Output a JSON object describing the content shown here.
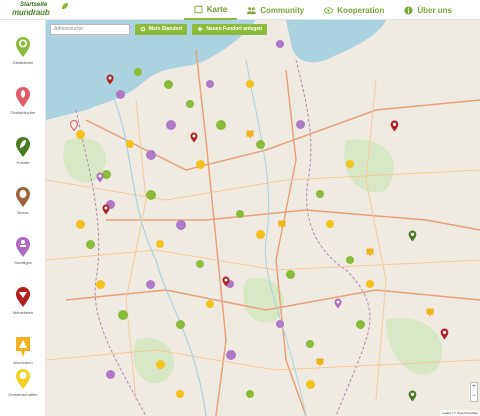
{
  "app": {
    "brand_top": "Startseite",
    "brand_bottom": "mundraub",
    "accent_color": "#8bbb3a"
  },
  "nav": [
    {
      "label": "Karte",
      "icon": "map-icon",
      "active": true
    },
    {
      "label": "Community",
      "icon": "community-icon",
      "active": false
    },
    {
      "label": "Kooperation",
      "icon": "cooperation-icon",
      "active": false
    },
    {
      "label": "Über uns",
      "icon": "info-icon",
      "active": false
    }
  ],
  "sidebar": {
    "categories": [
      {
        "label": "Obstbäume",
        "icon": "fruit-tree-icon",
        "color": "#8bbb3a"
      },
      {
        "label": "Obststräucher",
        "icon": "berry-bush-icon",
        "color": "#e05a6a"
      },
      {
        "label": "Kräuter",
        "icon": "herb-icon",
        "color": "#4a7a26"
      },
      {
        "label": "Nüsse",
        "icon": "nut-icon",
        "color": "#a0643a"
      },
      {
        "label": "Sonstiges",
        "icon": "misc-icon",
        "color": "#b06ac0"
      },
      {
        "label": "Meldelisten",
        "icon": "alert-list-icon",
        "color": "#b22020"
      },
      {
        "label": "Mundraum",
        "icon": "space-icon",
        "color": "#f0b21e"
      },
      {
        "label": "Gemeinschaften",
        "icon": "community-group-icon",
        "color": "#f3d120"
      }
    ]
  },
  "map": {
    "search_placeholder": "Adresssuche",
    "my_location_label": "Mein Standort",
    "new_find_label": "Neuen Fundort anlegen",
    "zoom_in": "+",
    "zoom_out": "−",
    "attribution": "Leaflet | © OpenStreetMap",
    "cluster_colors": {
      "green": "#8bbb3a",
      "purple": "#b079c5",
      "yellow": "#f3c21c",
      "orange": "#f2a826"
    }
  }
}
